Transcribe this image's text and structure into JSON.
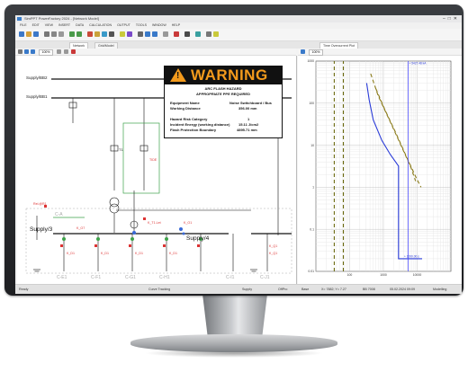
{
  "app": {
    "title": "SimPPT PowerFactory 2024 - [Network Model]",
    "menu": [
      "FILE",
      "EDIT",
      "VIEW",
      "INSERT",
      "DATA",
      "CALCULATION",
      "OUTPUT",
      "TOOLS",
      "WINDOW",
      "HELP"
    ],
    "zoom_left": "100%",
    "zoom_right": "100%"
  },
  "tabs": {
    "network": "Network",
    "grid": "Grid/Model",
    "chart": "Time Overcurrent Plot"
  },
  "diagram": {
    "busbar_top": "Supply/BB2",
    "busbar_second": "Supply/BB1",
    "bus_left": "Supply/3",
    "bus_right": "Supply/4",
    "cubicles_bottom": [
      "C-E1",
      "C-F1",
      "C-G1",
      "C-H1",
      "C-I1",
      "C-J1"
    ],
    "cubicle_top": "C-A",
    "relay_labels": [
      "Rel.@R1",
      "K_O7",
      "K_T1.Let",
      "K_O1",
      "K_D1",
      "K_D1",
      "K_D1",
      "K_D1",
      "K_Q1",
      "K_Q1"
    ],
    "trafo_label": "T1",
    "tide_label": "TIDE"
  },
  "warning": {
    "title": "WARNING",
    "subtitle1": "ARC FLASH HAZARD",
    "subtitle2": "APPROPRIATE PPE REQUIRED",
    "rows": [
      {
        "label": "Equipment Name",
        "value": "Noise Switchboard / Bus"
      },
      {
        "label": "Working Distance",
        "value": "356.00   mm"
      },
      {
        "label": "Hazard Risk Category",
        "value": "1"
      },
      {
        "label": "Incident Energy (working distance)",
        "value": "15.11   J/cm2"
      },
      {
        "label": "Flash Protection Boundary",
        "value": "4895.71   mm"
      }
    ]
  },
  "chart_data": {
    "type": "line",
    "title": "",
    "xlabel": "",
    "ylabel": "",
    "x_scale": "log",
    "y_scale": "log",
    "xlim": [
      10,
      100000
    ],
    "ylim": [
      0.01,
      1000
    ],
    "x_ticks": [
      "100",
      "1000",
      "10000"
    ],
    "y_ticks": [
      "1000",
      "100",
      "10",
      "1",
      "0.1",
      "0.01"
    ],
    "annotation_top": "+ 5427.48 kA",
    "annotation_right": "+ 1000.00 s",
    "series": [
      {
        "color": "#2a3bd8",
        "style": "solid",
        "points": [
          [
            320,
            300
          ],
          [
            380,
            120
          ],
          [
            500,
            40
          ],
          [
            900,
            13
          ],
          [
            1600,
            6
          ],
          [
            2800,
            3.2
          ],
          [
            2800,
            0.02
          ],
          [
            14000,
            0.02
          ]
        ]
      },
      {
        "color": "#8a7a18",
        "style": "dashed",
        "points": [
          [
            420,
            500
          ],
          [
            700,
            150
          ],
          [
            1500,
            40
          ],
          [
            3500,
            9
          ],
          [
            6500,
            3
          ],
          [
            9000,
            1.4
          ]
        ]
      },
      {
        "color": "#8a7a18",
        "style": "dashed",
        "points": [
          [
            600,
            220
          ],
          [
            1100,
            70
          ],
          [
            2300,
            20
          ],
          [
            5000,
            5
          ],
          [
            9000,
            1.8
          ],
          [
            13000,
            1
          ]
        ]
      },
      {
        "color": "#3a3aff",
        "style": "vertical",
        "points": [
          [
            5427,
            0.01
          ],
          [
            5427,
            1000
          ]
        ]
      },
      {
        "color": "#6b6a10",
        "style": "vertical-dashed",
        "points": [
          [
            35,
            0.01
          ],
          [
            35,
            1000
          ]
        ]
      },
      {
        "color": "#6b6a10",
        "style": "vertical-dashed",
        "points": [
          [
            65,
            0.01
          ],
          [
            65,
            1000
          ]
        ]
      }
    ]
  },
  "status": {
    "ready": "Ready",
    "mode": "Curve Tracking",
    "grid": "Supply",
    "offln": "OffPro",
    "base": "Base",
    "coords": "X= 7882; Y= 7.27",
    "zoom": "BB 7008",
    "date": "05.02.2024 09:09",
    "mode2": "Modelling"
  }
}
